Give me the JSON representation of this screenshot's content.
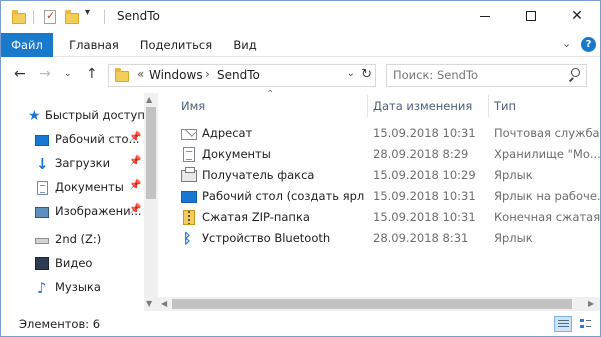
{
  "window": {
    "title": "SendTo",
    "quick_access": [
      "folder-icon",
      "properties-icon",
      "new-folder-icon",
      "customize-dropdown-icon"
    ],
    "controls": [
      "minimize",
      "maximize",
      "close"
    ]
  },
  "ribbon": {
    "tabs": [
      {
        "label": "Файл",
        "active": true
      },
      {
        "label": "Главная"
      },
      {
        "label": "Поделиться"
      },
      {
        "label": "Вид"
      }
    ],
    "accent_color": "#1979ca"
  },
  "nav": {
    "breadcrumb_prefix": "«",
    "breadcrumb": [
      "Windows",
      "SendTo"
    ],
    "search_placeholder": "Поиск: SendTo"
  },
  "sidebar": {
    "items": [
      {
        "label": "Быстрый доступ",
        "icon": "star-icon"
      },
      {
        "label": "Рабочий сто...",
        "icon": "desktop-icon",
        "pinned": true
      },
      {
        "label": "Загрузки",
        "icon": "download-icon",
        "pinned": true
      },
      {
        "label": "Документы",
        "icon": "documents-icon",
        "pinned": true
      },
      {
        "label": "Изображени...",
        "icon": "pictures-icon",
        "pinned": true
      },
      {
        "label": "2nd (Z:)",
        "icon": "drive-icon"
      },
      {
        "label": "Видео",
        "icon": "video-icon"
      },
      {
        "label": "Музыка",
        "icon": "music-icon"
      }
    ]
  },
  "list": {
    "columns": [
      "Имя",
      "Дата изменения",
      "Тип"
    ],
    "rows": [
      {
        "name": "Адресат",
        "date": "15.09.2018 10:31",
        "type": "Почтовая служба",
        "icon": "mail-recipient-icon"
      },
      {
        "name": "Документы",
        "date": "28.09.2018 8:29",
        "type": "Хранилище \"Мо...",
        "icon": "documents-icon"
      },
      {
        "name": "Получатель факса",
        "date": "15.09.2018 10:29",
        "type": "Ярлык",
        "icon": "fax-icon"
      },
      {
        "name": "Рабочий стол (создать ярл...",
        "date": "15.09.2018 10:31",
        "type": "Ярлык на рабоче...",
        "icon": "desktop-icon"
      },
      {
        "name": "Сжатая ZIP-папка",
        "date": "15.09.2018 10:31",
        "type": "Конечная сжатая ...",
        "icon": "zip-folder-icon"
      },
      {
        "name": "Устройство Bluetooth",
        "date": "28.09.2018 8:31",
        "type": "Ярлык",
        "icon": "bluetooth-icon"
      }
    ]
  },
  "status": {
    "item_count": "Элементов: 6",
    "views": [
      "details",
      "large-icons"
    ]
  }
}
